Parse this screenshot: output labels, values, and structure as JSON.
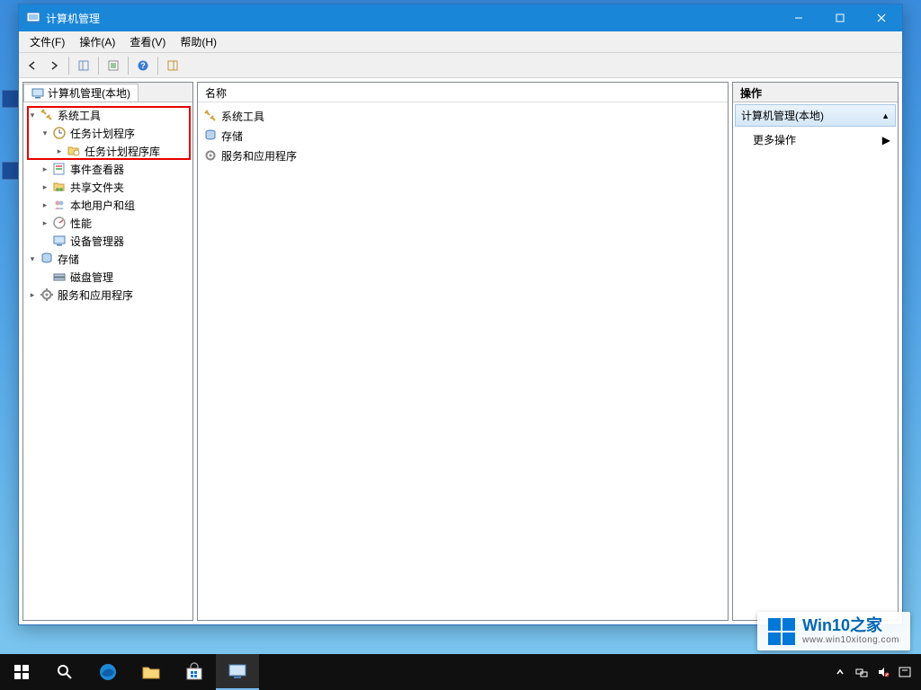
{
  "window": {
    "title": "计算机管理"
  },
  "menubar": {
    "file": "文件(F)",
    "action": "操作(A)",
    "view": "查看(V)",
    "help": "帮助(H)"
  },
  "tree": {
    "root": "计算机管理(本地)",
    "system_tools": "系统工具",
    "task_scheduler": "任务计划程序",
    "task_scheduler_lib": "任务计划程序库",
    "event_viewer": "事件查看器",
    "shared_folders": "共享文件夹",
    "local_users": "本地用户和组",
    "performance": "性能",
    "device_manager": "设备管理器",
    "storage": "存储",
    "disk_mgmt": "磁盘管理",
    "services_apps": "服务和应用程序"
  },
  "list": {
    "column_name": "名称",
    "items": {
      "system_tools": "系统工具",
      "storage": "存储",
      "services_apps": "服务和应用程序"
    }
  },
  "actions": {
    "header": "操作",
    "context": "计算机管理(本地)",
    "more": "更多操作"
  },
  "watermark": {
    "main": "Win10之家",
    "url": "www.win10xitong.com"
  }
}
